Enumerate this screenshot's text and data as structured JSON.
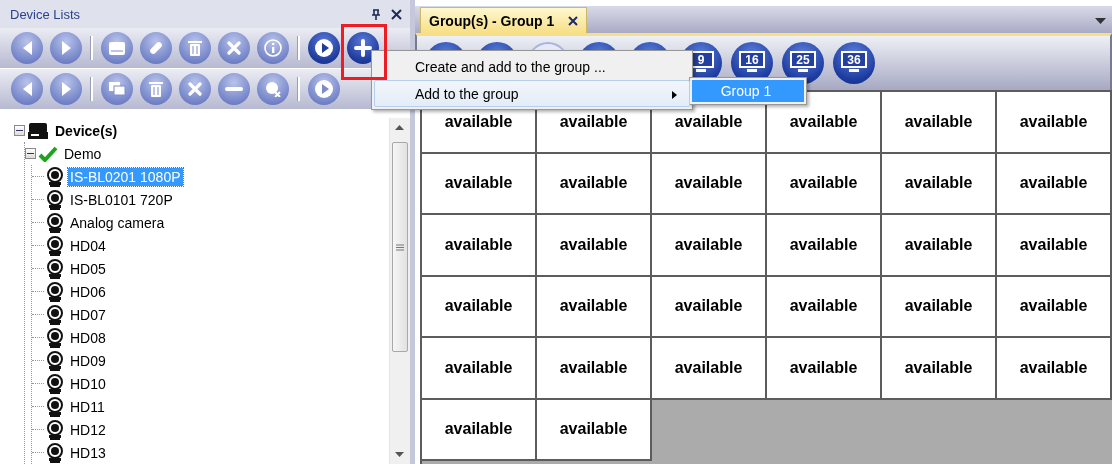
{
  "device_panel": {
    "title": "Device Lists",
    "toolbar_1": [
      {
        "kind": "button",
        "active": false
      },
      {
        "kind": "button",
        "active": false
      },
      {
        "kind": "separator"
      },
      {
        "kind": "button",
        "active": false
      },
      {
        "kind": "button",
        "active": false
      },
      {
        "kind": "button",
        "active": false
      },
      {
        "kind": "button",
        "active": false
      },
      {
        "kind": "button",
        "active": false
      },
      {
        "kind": "separator"
      },
      {
        "kind": "button",
        "active": true
      },
      {
        "kind": "button",
        "active": true,
        "highlighted": true
      }
    ],
    "toolbar_2": [
      {
        "kind": "button",
        "active": false
      },
      {
        "kind": "button",
        "active": false
      },
      {
        "kind": "separator"
      },
      {
        "kind": "button",
        "active": false
      },
      {
        "kind": "button",
        "active": false
      },
      {
        "kind": "button",
        "active": false
      },
      {
        "kind": "button",
        "active": false
      },
      {
        "kind": "button",
        "active": false
      },
      {
        "kind": "separator"
      },
      {
        "kind": "button",
        "active": false
      }
    ],
    "tree": [
      {
        "kind": "root",
        "label": "Device(s)",
        "expanded": true,
        "selected": false,
        "children": [
          {
            "kind": "site",
            "label": "Demo",
            "expanded": true,
            "online": true,
            "selected": false,
            "children": [
              {
                "kind": "camera",
                "label": "IS-BL0201 1080P",
                "selected": true
              },
              {
                "kind": "camera",
                "label": "IS-BL0101 720P",
                "selected": false
              },
              {
                "kind": "camera",
                "label": "Analog camera",
                "selected": false
              },
              {
                "kind": "camera",
                "label": "HD04",
                "selected": false
              },
              {
                "kind": "camera",
                "label": "HD05",
                "selected": false
              },
              {
                "kind": "camera",
                "label": "HD06",
                "selected": false
              },
              {
                "kind": "camera",
                "label": "HD07",
                "selected": false
              },
              {
                "kind": "camera",
                "label": "HD08",
                "selected": false
              },
              {
                "kind": "camera",
                "label": "HD09",
                "selected": false
              },
              {
                "kind": "camera",
                "label": "HD10",
                "selected": false
              },
              {
                "kind": "camera",
                "label": "HD11",
                "selected": false
              },
              {
                "kind": "camera",
                "label": "HD12",
                "selected": false
              },
              {
                "kind": "camera",
                "label": "HD13",
                "selected": false
              }
            ]
          }
        ]
      }
    ]
  },
  "context_menu": {
    "items": [
      {
        "label": "Create and add to the group ...",
        "selected": false
      },
      {
        "label": "Add to the group",
        "selected": true,
        "submenu": [
          {
            "label": "Group 1",
            "selected": true
          }
        ]
      }
    ]
  },
  "group_panel": {
    "tabs": [
      {
        "label": "Group(s) - Group 1",
        "selected": true
      }
    ],
    "toolbar": [
      {
        "kind": "plain",
        "disabled": false
      },
      {
        "kind": "plain",
        "disabled": false
      },
      {
        "kind": "plain",
        "disabled": true
      },
      {
        "kind": "plain",
        "disabled": false
      },
      {
        "kind": "plain",
        "disabled": false
      },
      {
        "kind": "layout",
        "label": "9",
        "disabled": false
      },
      {
        "kind": "layout",
        "label": "16",
        "disabled": false
      },
      {
        "kind": "layout",
        "label": "25",
        "disabled": false
      },
      {
        "kind": "layout",
        "label": "36",
        "disabled": false
      }
    ],
    "cells": [
      "available",
      "available",
      "available",
      "available",
      "available",
      "available",
      "available",
      "available",
      "available",
      "available",
      "available",
      "available",
      "available",
      "available",
      "available",
      "available",
      "available",
      "available",
      "available",
      "available",
      "available",
      "available",
      "available",
      "available",
      "available",
      "available",
      "available",
      "available",
      "available",
      "available",
      "available",
      "available"
    ]
  }
}
